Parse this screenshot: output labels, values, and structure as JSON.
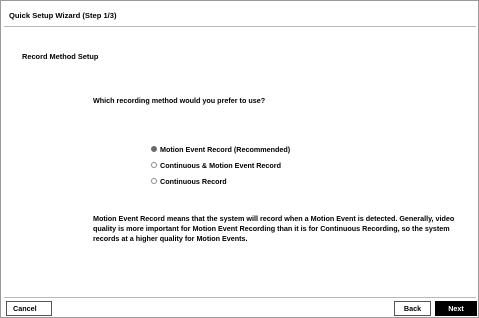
{
  "window": {
    "title": "Quick Setup Wizard (Step 1/3)"
  },
  "section": {
    "title": "Record Method Setup"
  },
  "question": "Which recording method would you prefer to use?",
  "options": [
    {
      "label": "Motion Event Record (Recommended)",
      "selected": true
    },
    {
      "label": "Continuous & Motion Event Record",
      "selected": false
    },
    {
      "label": "Continuous Record",
      "selected": false
    }
  ],
  "description": "Motion Event Record means that the system will record when a Motion Event is detected. Generally, video quality is more important for Motion Event Recording than it is for Continuous Recording, so the system records at a higher quality for Motion Events.",
  "buttons": {
    "cancel": "Cancel",
    "back": "Back",
    "next": "Next"
  },
  "colors": {
    "selected_radio": "#6a6a6a",
    "next_button_bg": "#000000"
  }
}
